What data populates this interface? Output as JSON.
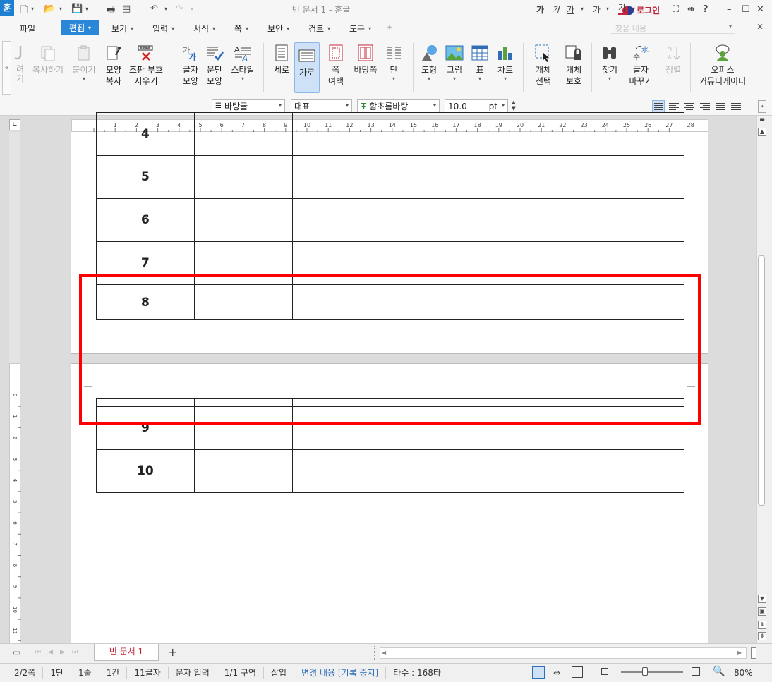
{
  "app": {
    "icon_glyph": "훈",
    "window_title": "빈 문서 1 - 훈글",
    "login_label": "로그인"
  },
  "menus": [
    {
      "label": "파일"
    },
    {
      "label": "편집"
    },
    {
      "label": "보기"
    },
    {
      "label": "입력"
    },
    {
      "label": "서식"
    },
    {
      "label": "쪽"
    },
    {
      "label": "보안"
    },
    {
      "label": "검토"
    },
    {
      "label": "도구"
    }
  ],
  "search": {
    "placeholder": "찾을 내용"
  },
  "ribbon": {
    "copy_format_disabled": "려기",
    "copy": "복사하기",
    "paste": "붙이기",
    "shape_copy": "모양\n복사",
    "markup_clear": "조판 부호\n지우기",
    "char_shape": "글자\n모양",
    "para_shape": "문단\n모양",
    "style": "스타일",
    "portrait": "세로",
    "landscape": "가로",
    "page_margin": "쪽\n여백",
    "bg_page": "바탕쪽",
    "columns": "단",
    "shapes": "도형",
    "picture": "그림",
    "table": "표",
    "chart": "차트",
    "obj_select": "개체\n선택",
    "obj_protect": "개체\n보호",
    "find": "찾기",
    "char_replace": "글자\n바꾸기",
    "sort": "정렬",
    "community": "오피스\n커뮤니케이터"
  },
  "format": {
    "style": "바탕글",
    "lang": "대표",
    "font": "함초롬바탕",
    "size": "10.0",
    "unit": "pt"
  },
  "ruler": {
    "h_ticks": [
      "1",
      "2",
      "3",
      "4",
      "5",
      "6",
      "7",
      "8",
      "9",
      "10",
      "11",
      "12",
      "13",
      "14",
      "15",
      "16",
      "17",
      "18",
      "19",
      "20",
      "21",
      "22",
      "23",
      "24",
      "25",
      "26",
      "27",
      "28"
    ],
    "v_ticks": [
      "0",
      "1",
      "2",
      "3",
      "4",
      "5",
      "6",
      "7",
      "8",
      "9",
      "10",
      "11"
    ]
  },
  "table_page1": {
    "rows": [
      "4",
      "5",
      "6",
      "7",
      "8"
    ]
  },
  "table_page2": {
    "rows": [
      "",
      "9",
      "10"
    ]
  },
  "tab": {
    "doc_name": "빈 문서 1",
    "add": "+"
  },
  "status": {
    "page": "2/2쪽",
    "column": "1단",
    "line": "1줄",
    "col": "1칸",
    "chars": "11글자",
    "mode": "문자 입력",
    "section": "1/1 구역",
    "insert": "삽입",
    "track": "변경 내용 [기록 중지]",
    "keystrokes": "타수 : 168타",
    "zoom": "80%"
  },
  "colors": {
    "accent": "#2a87d8",
    "highlight": "#ff0000",
    "brand": "#c0243a"
  }
}
